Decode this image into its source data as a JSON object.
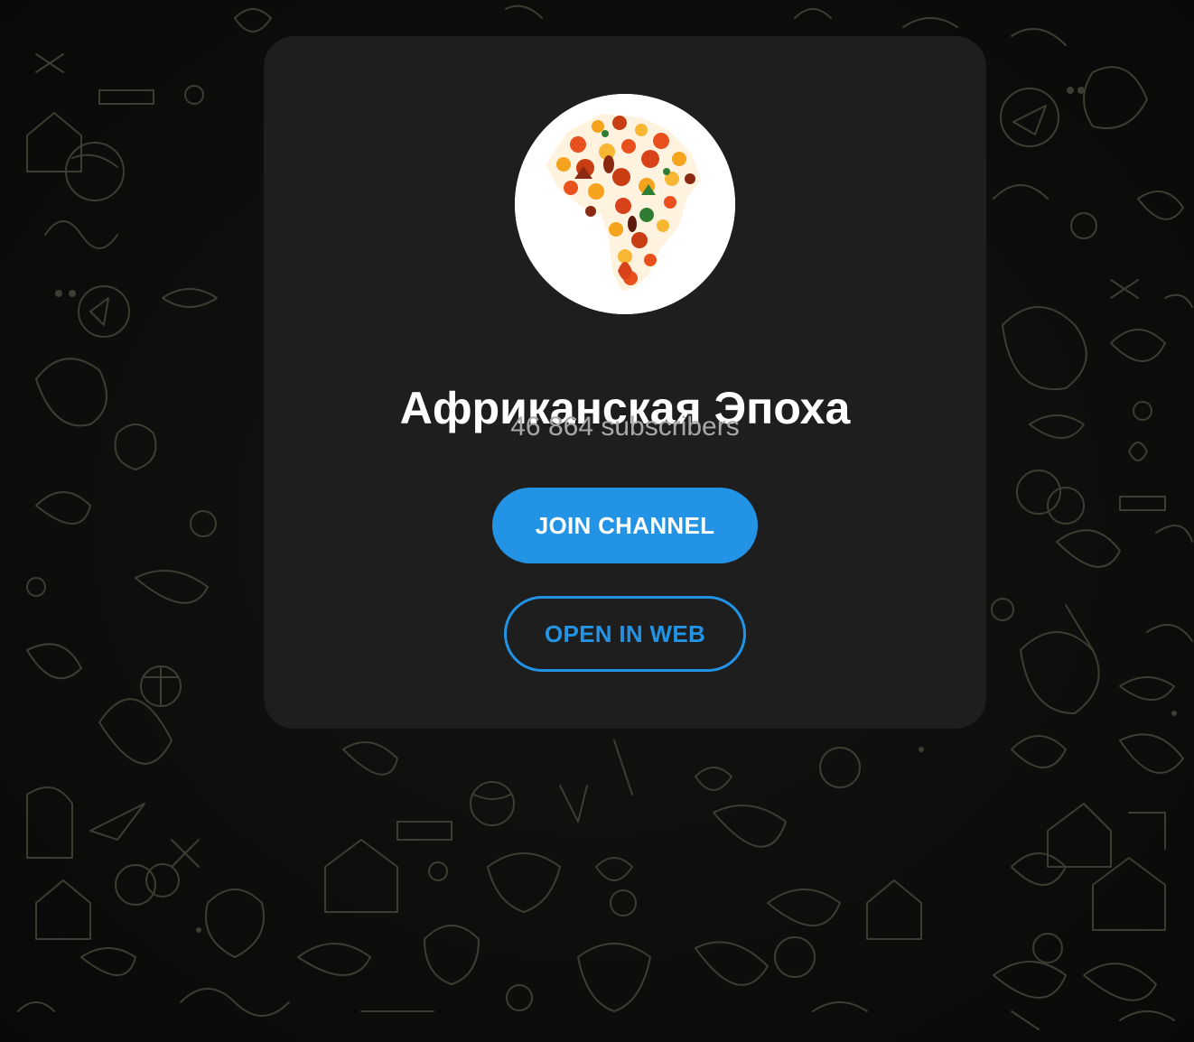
{
  "channel": {
    "name": "Африканская Эпоха",
    "subscribers": "46 864 subscribers"
  },
  "actions": {
    "join_label": "JOIN CHANNEL",
    "open_web_label": "OPEN IN WEB"
  },
  "colors": {
    "accent": "#2393e6",
    "card": "#1e1e1e",
    "background": "#0b0b0a",
    "pattern": "#3f3f33",
    "subtitle": "#a8a8a8"
  },
  "icons": {
    "avatar": "africa-map-icon",
    "background": "doodle-pattern"
  }
}
